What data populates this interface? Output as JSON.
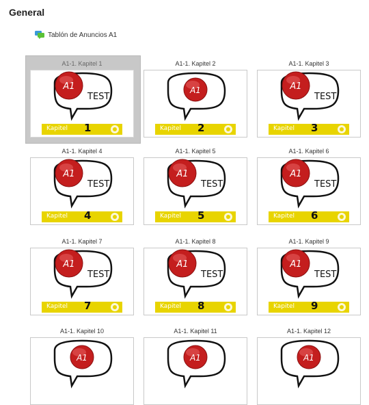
{
  "section": {
    "title": "General"
  },
  "forum": {
    "label": "Tablón de Anuncios A1"
  },
  "tiles": [
    {
      "label": "A1-1. Kapitel 1",
      "number": "1",
      "show_test": true
    },
    {
      "label": "A1-1. Kapitel 2",
      "number": "2",
      "show_test": false
    },
    {
      "label": "A1-1. Kapitel 3",
      "number": "3",
      "show_test": true
    },
    {
      "label": "A1-1. Kapitel 4",
      "number": "4",
      "show_test": true
    },
    {
      "label": "A1-1. Kapitel 5",
      "number": "5",
      "show_test": true
    },
    {
      "label": "A1-1. Kapitel 6",
      "number": "6",
      "show_test": true
    },
    {
      "label": "A1-1. Kapitel 7",
      "number": "7",
      "show_test": true
    },
    {
      "label": "A1-1. Kapitel 8",
      "number": "8",
      "show_test": true
    },
    {
      "label": "A1-1. Kapitel 9",
      "number": "9",
      "show_test": true
    },
    {
      "label": "A1-1. Kapitel 10",
      "number": "",
      "show_test": false
    },
    {
      "label": "A1-1. Kapitel 11",
      "number": "",
      "show_test": false
    },
    {
      "label": "A1-1. Kapitel 12",
      "number": "",
      "show_test": false
    }
  ],
  "badge_text": "A1",
  "test_text": "TEST",
  "bar_text": "Kapitel",
  "colors": {
    "accent": "#e8d400",
    "badge": "#c41e1e",
    "forum_icon": "#4caf50"
  }
}
